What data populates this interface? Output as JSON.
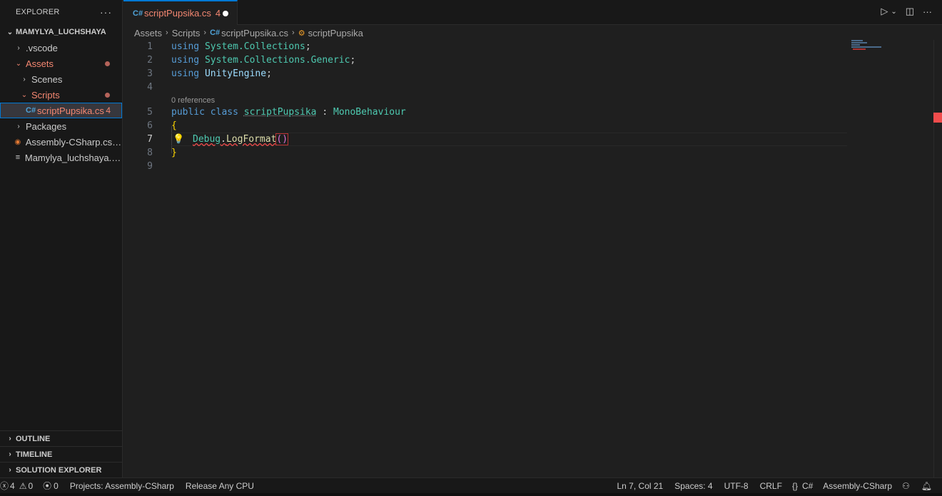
{
  "sidebar": {
    "title": "EXPLORER",
    "more": "···",
    "workspace": "MAMYLYA_LUCHSHAYA",
    "tree": [
      {
        "label": ".vscode"
      },
      {
        "label": "Assets"
      },
      {
        "label": "Scenes"
      },
      {
        "label": "Scripts"
      },
      {
        "label": "scriptPupsika.cs",
        "badge": "4"
      },
      {
        "label": "Packages"
      },
      {
        "label": "Assembly-CSharp.csp..."
      },
      {
        "label": "Mamylya_luchshaya.sln"
      }
    ],
    "sections": [
      "OUTLINE",
      "TIMELINE",
      "SOLUTION EXPLORER"
    ]
  },
  "tab": {
    "label": "scriptPupsika.cs",
    "problems": "4"
  },
  "breadcrumb": [
    "Assets",
    "Scripts",
    "scriptPupsika.cs",
    "scriptPupsika"
  ],
  "editor": {
    "line_numbers": [
      "1",
      "2",
      "3",
      "4",
      "5",
      "6",
      "7",
      "8",
      "9"
    ],
    "codelens": "0 references",
    "lines": {
      "l1_kw": "using",
      "l1_ns": "System.Collections",
      "l2_kw": "using",
      "l2_ns": "System.Collections.Generic",
      "l3_kw": "using",
      "l3_ns": "UnityEngine",
      "l5_kw1": "public",
      "l5_kw2": "class",
      "l5_cls": "scriptPupsika",
      "l5_colon": ":",
      "l5_base": "MonoBehaviour",
      "l6": "{",
      "l7_obj": "Debug",
      "l7_method": "LogFormat",
      "l7_paren": "()",
      "l8": "}"
    }
  },
  "statusbar": {
    "errors": "4",
    "warnings": "0",
    "ports": "0",
    "projects": "Projects: Assembly-CSharp",
    "config": "Release Any CPU",
    "position": "Ln 7, Col 21",
    "spaces": "Spaces: 4",
    "encoding": "UTF-8",
    "eol": "CRLF",
    "language": "C#",
    "project": "Assembly-CSharp"
  },
  "colors": {
    "accent": "#0078d4",
    "modified": "#f48771",
    "error": "#f14c4c"
  }
}
